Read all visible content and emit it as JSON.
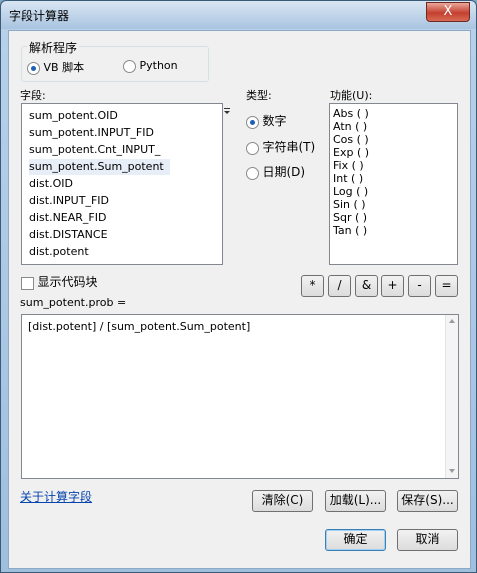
{
  "window": {
    "title": "字段计算器",
    "close_glyph": "X"
  },
  "parser": {
    "group_label": "解析程序",
    "options": [
      "VB 脚本",
      "Python"
    ],
    "selected": "VB 脚本"
  },
  "fields": {
    "label": "字段:",
    "items": [
      "sum_potent.OID",
      "sum_potent.INPUT_FID",
      "sum_potent.Cnt_INPUT_",
      "sum_potent.Sum_potent",
      "dist.OID",
      "dist.INPUT_FID",
      "dist.NEAR_FID",
      "dist.DISTANCE",
      "dist.potent"
    ],
    "selected": "sum_potent.Sum_potent"
  },
  "types": {
    "label": "类型:",
    "options": [
      "数字",
      "字符串(T)",
      "日期(D)"
    ],
    "selected": "数字"
  },
  "functions": {
    "label": "功能(U):",
    "items": [
      "Abs ( )",
      "Atn ( )",
      "Cos ( )",
      "Exp ( )",
      "Fix ( )",
      "Int ( )",
      "Log ( )",
      "Sin ( )",
      "Sqr ( )",
      "Tan ( )"
    ]
  },
  "code_block": {
    "label": "显示代码块",
    "checked": false
  },
  "operators": [
    "*",
    "/",
    "&",
    "+",
    "-",
    "="
  ],
  "expression": {
    "target_label": "sum_potent.prob =",
    "value": "[dist.potent] / [sum_potent.Sum_potent]"
  },
  "footer": {
    "about_link": "关于计算字段",
    "clear": "清除(C)",
    "load": "加载(L)...",
    "save": "保存(S)...",
    "ok": "确定",
    "cancel": "取消"
  },
  "icons": {
    "sort": "sort-triangle-icon"
  }
}
